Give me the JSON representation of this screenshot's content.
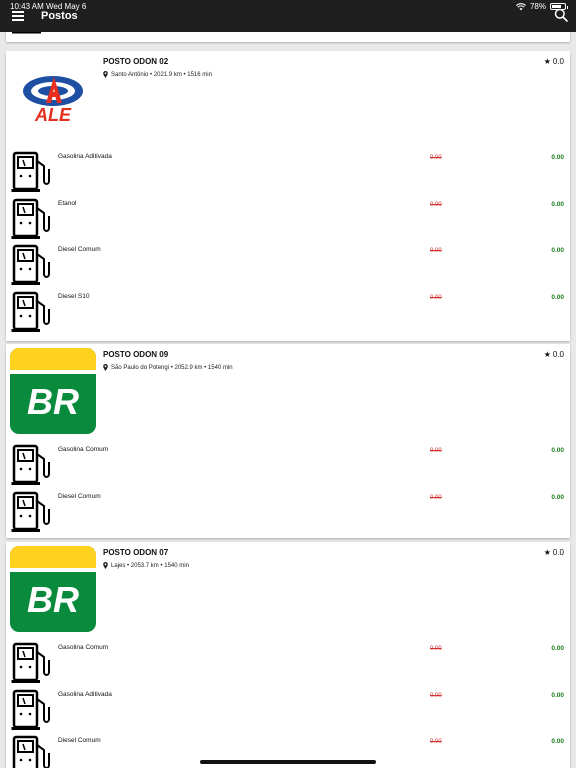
{
  "status_bar": {
    "time": "10:43 AM  Wed May 6",
    "battery": "78%",
    "battery_level": 0.78
  },
  "header": {
    "title": "Postos"
  },
  "stations": [
    {
      "name": "POSTO ODON 02",
      "location": "Santo Antônio • 2021.9 km • 1516 min",
      "rating": "0.0",
      "brand": "ALE",
      "fuels": [
        {
          "name": "Gasolina Aditivada",
          "old_price": "0.00",
          "price": "0.00"
        },
        {
          "name": "Etanol",
          "old_price": "0.00",
          "price": "0.00"
        },
        {
          "name": "Diesel Comum",
          "old_price": "0.00",
          "price": "0.00"
        },
        {
          "name": "Diesel S10",
          "old_price": "0.00",
          "price": "0.00"
        }
      ]
    },
    {
      "name": "POSTO ODON 09",
      "location": "São Paulo do Potengi • 2052.9 km • 1540 min",
      "rating": "0.0",
      "brand": "BR",
      "fuels": [
        {
          "name": "Gasolina Comum",
          "old_price": "0.00",
          "price": "0.00"
        },
        {
          "name": "Diesel Comum",
          "old_price": "0.00",
          "price": "0.00"
        }
      ]
    },
    {
      "name": "POSTO ODON 07",
      "location": "Lajes • 2053.7 km • 1540 min",
      "rating": "0.0",
      "brand": "BR",
      "fuels": [
        {
          "name": "Gasolina Comum",
          "old_price": "0.00",
          "price": "0.00"
        },
        {
          "name": "Gasolina Aditivada",
          "old_price": "0.00",
          "price": "0.00"
        },
        {
          "name": "Diesel Comum",
          "old_price": "0.00",
          "price": "0.00"
        }
      ]
    }
  ],
  "colors": {
    "header_bg": "#1f1f1f",
    "old_price": "#d32f2f",
    "new_price": "#1a7f1a",
    "ale_blue": "#1e4fa3",
    "ale_red": "#e53020",
    "br_green": "#0a8a3c",
    "br_yellow": "#ffd21f"
  }
}
